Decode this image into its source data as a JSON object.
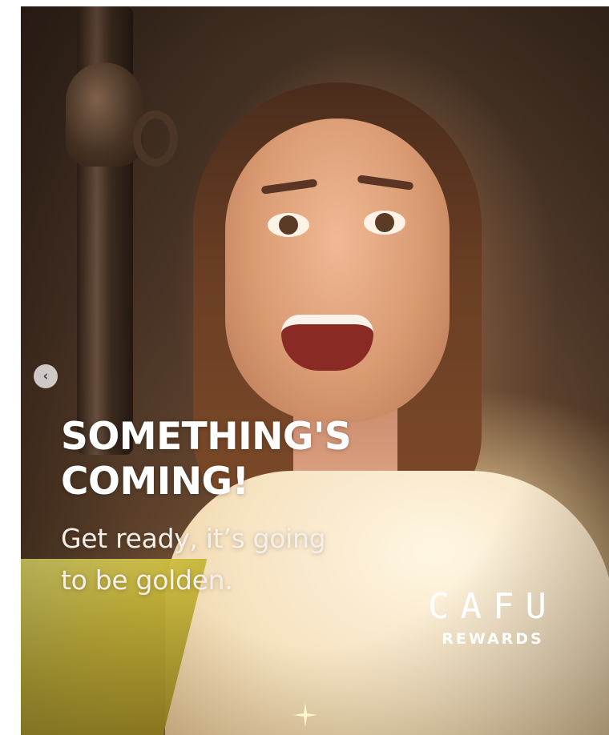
{
  "post": {
    "headline_line1": "SOMETHING'S",
    "headline_line2": "COMING!",
    "subline_line1": "Get ready, it’s going",
    "subline_line2": "to be golden.",
    "nav_prev_glyph": "‹"
  },
  "brand": {
    "word": "CAFU",
    "sub": "REWARDS"
  },
  "colors": {
    "headline": "#ffffff",
    "accent_gold": "#c8b83a"
  }
}
